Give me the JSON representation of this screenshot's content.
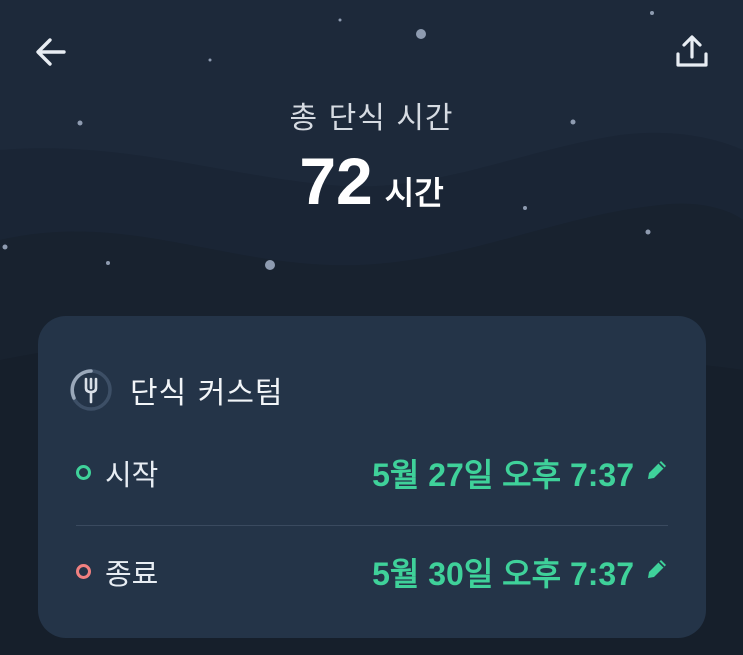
{
  "header": {
    "back_icon": "arrow-left-icon",
    "share_icon": "share-upload-icon"
  },
  "summary": {
    "label": "총 단식 시간",
    "value": "72",
    "unit": "시간"
  },
  "card": {
    "icon": "fork-progress-icon",
    "title": "단식 커스텀",
    "start": {
      "label": "시작",
      "time": "5월 27일 오후 7:37",
      "dot_color": "#3fd19a"
    },
    "end": {
      "label": "종료",
      "time": "5월 30일 오후 7:37",
      "dot_color": "#f08080"
    },
    "edit_icon": "pencil-icon"
  },
  "colors": {
    "background": "#17202e",
    "sky": "#1c2738",
    "card": "#243448",
    "accent": "#3fd19a"
  }
}
